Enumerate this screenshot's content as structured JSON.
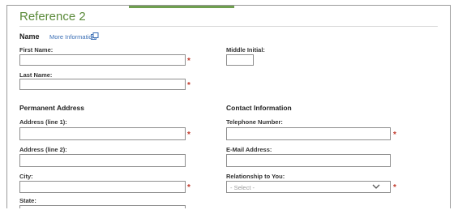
{
  "section": {
    "title": "Reference 2"
  },
  "name_group": {
    "heading": "Name",
    "more_info_link": "More Information",
    "first_name_label": "First Name:",
    "middle_initial_label": "Middle Initial:",
    "last_name_label": "Last Name:"
  },
  "address_group": {
    "heading": "Permanent Address",
    "line1_label": "Address (line 1):",
    "line2_label": "Address (line 2):",
    "city_label": "City:",
    "state_label": "State:"
  },
  "contact_group": {
    "heading": "Contact Information",
    "telephone_label": "Telephone Number:",
    "email_label": "E-Mail Address:",
    "relationship_label": "Relationship to You:",
    "relationship_selected": "- Select -"
  },
  "required_marker": "*",
  "colors": {
    "section_title": "#5b8a3a",
    "link": "#3b6fb5",
    "required": "#c0392b"
  }
}
